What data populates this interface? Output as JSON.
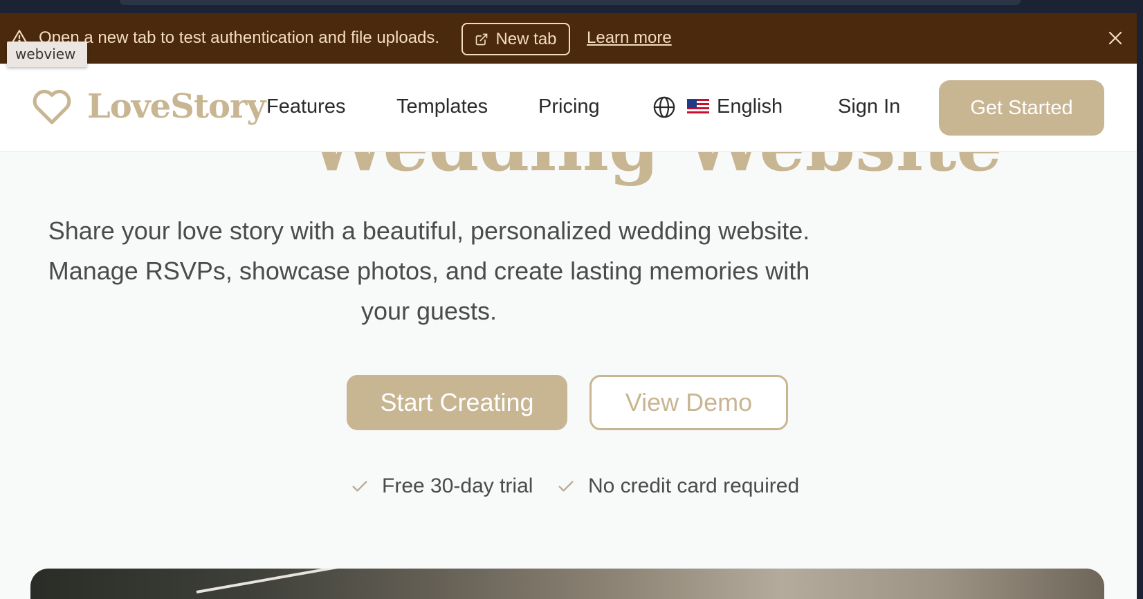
{
  "banner": {
    "message": "Open a new tab to test authentication and file uploads.",
    "new_tab_label": "New tab",
    "learn_more_label": "Learn more"
  },
  "tooltip": {
    "text": "webview"
  },
  "nav": {
    "brand": "LoveStory",
    "links": [
      "Features",
      "Templates",
      "Pricing"
    ],
    "language": "English",
    "sign_in": "Sign In",
    "get_started": "Get Started"
  },
  "hero": {
    "title_visible": "Wedding Website",
    "subtitle": "Share your love story with a beautiful, personalized wedding website. Manage RSVPs, showcase photos, and create lasting memories with your guests.",
    "primary_cta": "Start Creating",
    "secondary_cta": "View Demo",
    "perks": [
      "Free 30-day trial",
      "No credit card required"
    ]
  },
  "colors": {
    "accent": "#c8b592",
    "banner_bg": "#4b290c",
    "banner_text": "#f3dcc0",
    "page_bg": "#f8f9f9",
    "text": "#4b4b4b"
  },
  "icons": {
    "banner_warning": "warning-triangle-icon",
    "new_tab": "external-link-icon",
    "banner_close": "close-icon",
    "logo": "heart-icon",
    "language": "globe-icon",
    "flag": "us-flag-icon",
    "perk": "check-icon"
  }
}
